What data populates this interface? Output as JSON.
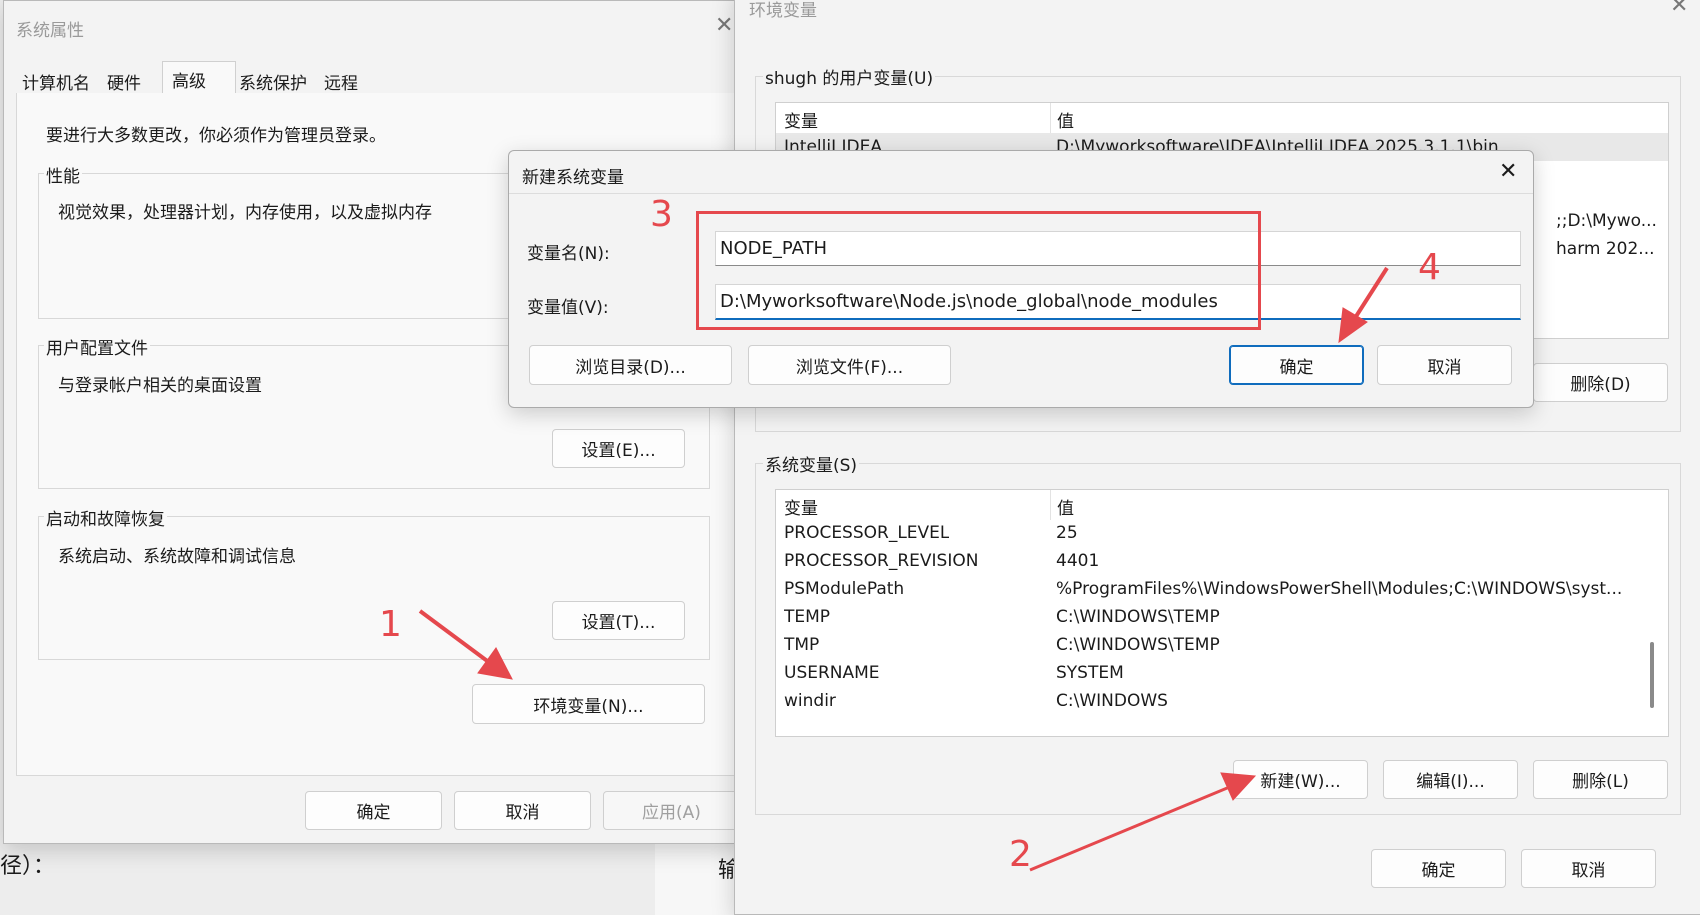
{
  "sysprops": {
    "title": "系统属性",
    "tabs": [
      "计算机名",
      "硬件",
      "高级",
      "系统保护",
      "远程"
    ],
    "admin_note": "要进行大多数更改，你必须作为管理员登录。",
    "perf": {
      "label": "性能",
      "desc": "视觉效果，处理器计划，内存使用，以及虚拟内存"
    },
    "profile": {
      "label": "用户配置文件",
      "desc": "与登录帐户相关的桌面设置",
      "button": "设置(E)..."
    },
    "startup": {
      "label": "启动和故障恢复",
      "desc": "系统启动、系统故障和调试信息",
      "button": "设置(T)..."
    },
    "env_button": "环境变量(N)...",
    "ok": "确定",
    "cancel": "取消",
    "apply": "应用(A)"
  },
  "envvars": {
    "title": "环境变量",
    "user_section": "shugh 的用户变量(U)",
    "list_header": {
      "name": "变量",
      "value": "值"
    },
    "user_rows": [
      {
        "name": "IntelliJ IDEA",
        "value": "D:\\Myworksoftware\\IDEA\\IntelliJ IDEA 2025.3.1.1\\bin"
      }
    ],
    "user_partial": [
      ";;D:\\Mywo...",
      "harm 202..."
    ],
    "user_delete": "删除(D)",
    "sys_section": "系统变量(S)",
    "sys_rows": [
      {
        "name": "PROCESSOR_LEVEL",
        "value": "25"
      },
      {
        "name": "PROCESSOR_REVISION",
        "value": "4401"
      },
      {
        "name": "PSModulePath",
        "value": "%ProgramFiles%\\WindowsPowerShell\\Modules;C:\\WINDOWS\\syst..."
      },
      {
        "name": "TEMP",
        "value": "C:\\WINDOWS\\TEMP"
      },
      {
        "name": "TMP",
        "value": "C:\\WINDOWS\\TEMP"
      },
      {
        "name": "USERNAME",
        "value": "SYSTEM"
      },
      {
        "name": "windir",
        "value": "C:\\WINDOWS"
      }
    ],
    "sys_new": "新建(W)...",
    "sys_edit": "编辑(I)...",
    "sys_delete": "删除(L)",
    "ok": "确定",
    "cancel": "取消"
  },
  "newvar": {
    "title": "新建系统变量",
    "name_label": "变量名(N):",
    "value_label": "变量值(V):",
    "name_value": "NODE_PATH",
    "value_value": "D:\\Myworksoftware\\Node.js\\node_global\\node_modules",
    "browse_dir": "浏览目录(D)...",
    "browse_file": "浏览文件(F)...",
    "ok": "确定",
    "cancel": "取消"
  },
  "background": {
    "left_text": "径）：",
    "mid_text": "输"
  },
  "annotations": {
    "n1": "1",
    "n2": "2",
    "n3": "3",
    "n4": "4",
    "color": "#e5484d"
  }
}
